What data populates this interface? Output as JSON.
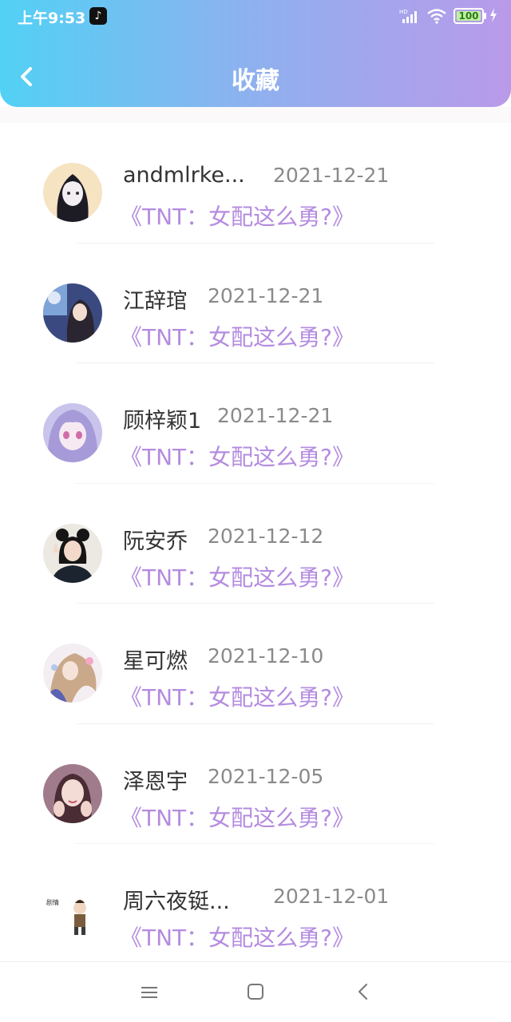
{
  "status_bar": {
    "time": "上午9:53",
    "battery": "100"
  },
  "header": {
    "title": "收藏"
  },
  "colors": {
    "accent": "#b48be0",
    "header_start": "#52d1f5",
    "header_end": "#b99ae9"
  },
  "favorites": [
    {
      "username": "andmlrke...",
      "date": "2021-12-21",
      "book": "《TNT：女配这么勇?》",
      "avatar": "anime-girl-dark-hair"
    },
    {
      "username": "江辞琯",
      "date": "2021-12-21",
      "book": "《TNT：女配这么勇?》",
      "avatar": "photo-girl-blue"
    },
    {
      "username": "顾梓颖1",
      "date": "2021-12-21",
      "book": "《TNT：女配这么勇?》",
      "avatar": "anime-girl-purple"
    },
    {
      "username": "阮安乔",
      "date": "2021-12-12",
      "book": "《TNT：女配这么勇?》",
      "avatar": "photo-girl-peace-sign"
    },
    {
      "username": "星可燃",
      "date": "2021-12-10",
      "book": "《TNT：女配这么勇?》",
      "avatar": "anime-girl-flowers"
    },
    {
      "username": "泽恩宇",
      "date": "2021-12-05",
      "book": "《TNT：女配这么勇?》",
      "avatar": "photo-girl-pink"
    },
    {
      "username": "周六夜铤...",
      "date": "2021-12-01",
      "book": "《TNT：女配这么勇?》",
      "avatar": "cartoon-character"
    }
  ],
  "nav": {
    "menu_icon": "menu-icon",
    "home_icon": "home-icon",
    "back_icon": "back-icon"
  }
}
